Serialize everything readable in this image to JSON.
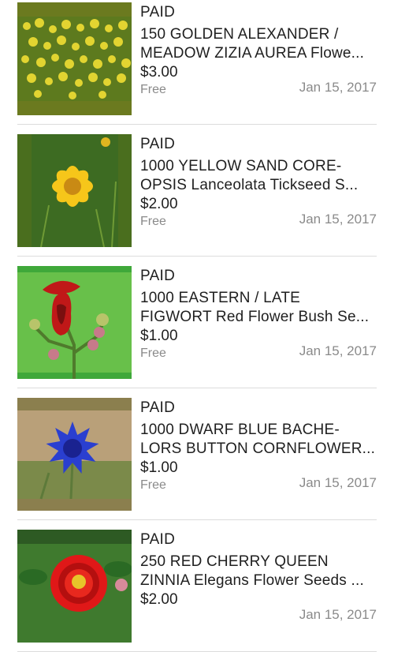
{
  "orders": [
    {
      "status": "PAID",
      "title_line1": "150 GOLDEN ALEXANDER /",
      "title_line2": "MEADOW ZIZIA AUREA Flowe...",
      "price": "$3.00",
      "shipping": "Free",
      "date": "Jan 15, 2017",
      "image_icon": "yellow-umbel-flowers-image",
      "frame_color": "#6b7a1f"
    },
    {
      "status": "PAID",
      "title_line1": "1000 YELLOW SAND CORE-",
      "title_line2": "OPSIS Lanceolata Tickseed S...",
      "price": "$2.00",
      "shipping": "Free",
      "date": "Jan 15, 2017",
      "image_icon": "yellow-coreopsis-flower-image",
      "frame_color": "#4a6e1e"
    },
    {
      "status": "PAID",
      "title_line1": "1000 EASTERN / LATE",
      "title_line2": "FIGWORT Red Flower Bush Se...",
      "price": "$1.00",
      "shipping": "Free",
      "date": "Jan 15, 2017",
      "image_icon": "red-figwort-flower-image",
      "frame_color": "#3fa83a"
    },
    {
      "status": "PAID",
      "title_line1": "1000 DWARF BLUE BACHE-",
      "title_line2": "LORS BUTTON CORNFLOWER...",
      "price": "$1.00",
      "shipping": "Free",
      "date": "Jan 15, 2017",
      "image_icon": "blue-cornflower-image",
      "frame_color": "#8b7f4e"
    },
    {
      "status": "PAID",
      "title_line1": "250 RED CHERRY QUEEN",
      "title_line2": "ZINNIA Elegans Flower Seeds ...",
      "price": "$2.00",
      "shipping": "",
      "date": "Jan 15, 2017",
      "image_icon": "red-zinnia-flower-image",
      "frame_color": "#2d5a23"
    }
  ]
}
